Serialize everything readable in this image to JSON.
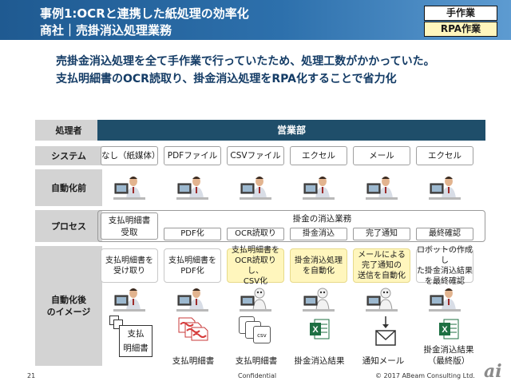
{
  "header": {
    "title_line1": "事例1:OCRと連携した紙処理の効率化",
    "title_line2": "商社｜売掛消込処理業務",
    "tag_manual": "手作業",
    "tag_rpa": "RPA作業"
  },
  "summary": {
    "line1": "売掛金消込処理を全て手作業で行っていたため、処理工数がかかっていた。",
    "line2": "支払明細書のOCR読取り、掛金消込処理をRPA化することで省力化"
  },
  "rows": {
    "processor": "処理者",
    "system": "システム",
    "before": "自動化前",
    "process": "プロセス",
    "after_line1": "自動化後",
    "after_line2": "のイメージ"
  },
  "department": "営業部",
  "systems": [
    "なし（紙媒体）",
    "PDFファイル",
    "CSVファイル",
    "エクセル",
    "メール",
    "エクセル"
  ],
  "process": {
    "first_line1": "支払明細書",
    "first_line2": "受取",
    "group": "掛金の消込業務",
    "steps": [
      "PDF化",
      "OCR読取り",
      "掛金消込",
      "完了通知",
      "最終確認"
    ]
  },
  "after_cards": [
    {
      "line1": "支払明細書を",
      "line2": "受け取り",
      "line3": ""
    },
    {
      "line1": "支払明細書を",
      "line2": "PDF化",
      "line3": ""
    },
    {
      "line1": "支払明細書を",
      "line2": "OCR読取りし、",
      "line3": "CSV化"
    },
    {
      "line1": "掛金消込処理",
      "line2": "を自動化",
      "line3": ""
    },
    {
      "line1": "メールによる",
      "line2": "完了通知の",
      "line3": "送信を自動化"
    },
    {
      "line1": "ロボットの作成し",
      "line2": "た掛金消込結果",
      "line3": "を最終確認"
    }
  ],
  "paper_doc": {
    "line1": "支払",
    "line2": "明細書"
  },
  "csv_icon_label": "csv",
  "outputs": [
    "支払明細書",
    "支払明細書",
    "掛金消込結果",
    "通知メール",
    "掛金消込結果",
    "（最終版）"
  ],
  "footer": {
    "page": "21",
    "confidential": "Confidential",
    "copyright": "© 2017 ABeam Consulting Ltd.",
    "watermark": "ai"
  },
  "colors": {
    "header_blue": "#1f5a91",
    "department_navy": "#1f4e6a",
    "rpa_yellow": "#fff6bd",
    "row_label_gray": "#d3d3d3",
    "summary_text": "#143c66"
  }
}
